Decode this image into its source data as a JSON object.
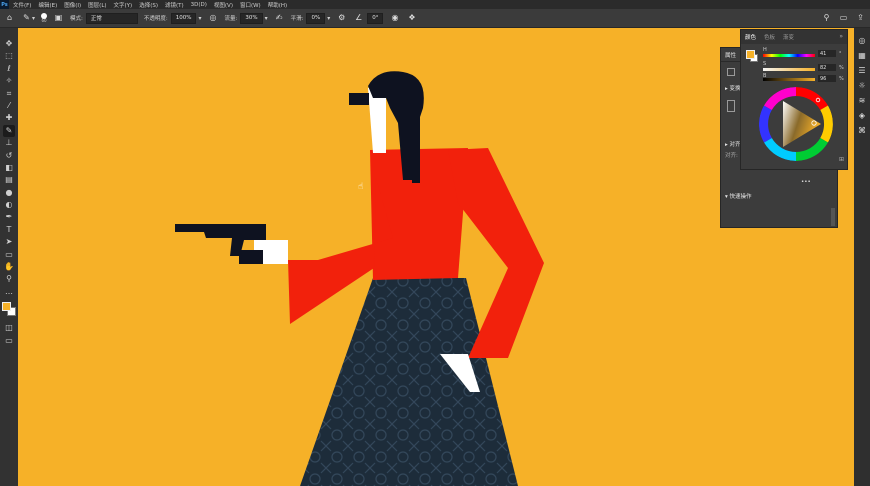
{
  "menubar": {
    "app_icon": "Ps",
    "items": [
      "文件(F)",
      "编辑(E)",
      "图像(I)",
      "图层(L)",
      "文字(Y)",
      "选择(S)",
      "滤镜(T)",
      "3D(D)",
      "视图(V)",
      "窗口(W)",
      "帮助(H)"
    ]
  },
  "options": {
    "brush_size": "60",
    "mode_label": "模式:",
    "mode_value": "正常",
    "opacity_label": "不透明度:",
    "opacity_value": "100%",
    "flow_label": "流量:",
    "flow_value": "30%",
    "smoothing_label": "平滑:",
    "smoothing_value": "0%",
    "angle_value": "0°"
  },
  "colors": {
    "foreground": "#f6b128",
    "background": "#ffffff",
    "canvas": "#f6b128"
  },
  "color_panel": {
    "tabs": [
      "颜色",
      "色板",
      "渐变"
    ],
    "h_label": "H",
    "s_label": "S",
    "b_label": "B",
    "h_value": "41",
    "s_value": "82",
    "b_value": "96",
    "h_pct": "°",
    "s_pct": "%",
    "b_pct": "%"
  },
  "props_panel": {
    "title": "属性",
    "section_transform": "变换",
    "section_align": "对齐",
    "section_align_sub": "对齐:",
    "section_quick": "快速操作",
    "more": "•••"
  },
  "tools": [
    "move-icon",
    "marquee-icon",
    "lasso-icon",
    "quick-select-icon",
    "crop-icon",
    "eyedropper-icon",
    "healing-icon",
    "brush-icon",
    "stamp-icon",
    "history-brush-icon",
    "eraser-icon",
    "gradient-icon",
    "blur-icon",
    "dodge-icon",
    "pen-icon",
    "type-icon",
    "path-select-icon",
    "shape-icon",
    "hand-icon",
    "zoom-icon",
    "more-tools-icon"
  ]
}
